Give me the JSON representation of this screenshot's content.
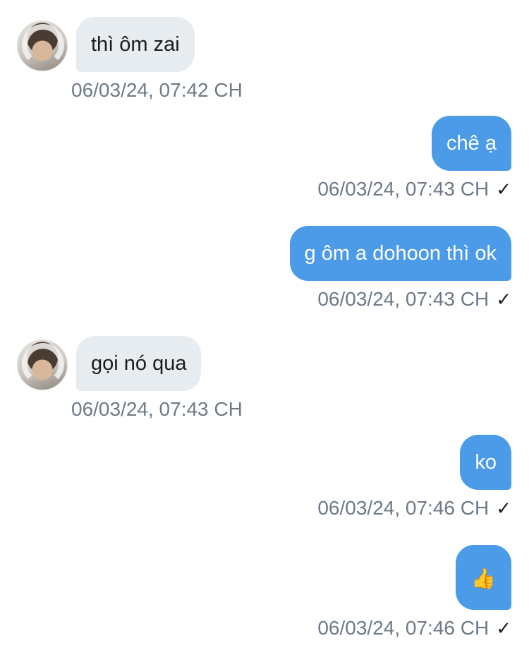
{
  "messages": [
    {
      "direction": "incoming",
      "text": "thì ôm zai",
      "timestamp": "06/03/24, 07:42 CH"
    },
    {
      "direction": "outgoing",
      "text": "chê ạ",
      "timestamp": "06/03/24, 07:43 CH",
      "status": "✓"
    },
    {
      "direction": "outgoing",
      "text": "g ôm a dohoon thì ok",
      "timestamp": "06/03/24, 07:43 CH",
      "status": "✓"
    },
    {
      "direction": "incoming",
      "text": "gọi nó qua",
      "timestamp": "06/03/24, 07:43 CH"
    },
    {
      "direction": "outgoing",
      "text": "ko",
      "timestamp": "06/03/24, 07:46 CH",
      "status": "✓"
    },
    {
      "direction": "outgoing",
      "text": "👍",
      "timestamp": "06/03/24, 07:46 CH",
      "status": "✓"
    }
  ],
  "colors": {
    "outgoing_bubble": "#4c9be8",
    "incoming_bubble": "#e7ecf0",
    "timestamp_text": "#6e7a88"
  }
}
